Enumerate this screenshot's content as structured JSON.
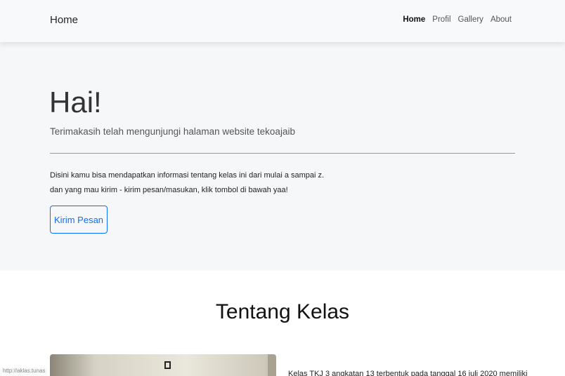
{
  "navbar": {
    "brand": "Home",
    "links": [
      {
        "label": "Home",
        "active": true
      },
      {
        "label": "Profil",
        "active": false
      },
      {
        "label": "Gallery",
        "active": false
      },
      {
        "label": "About",
        "active": false
      }
    ]
  },
  "hero": {
    "heading": "Hai!",
    "lead": "Terimakasih telah mengunjungi halaman website tekoajaib",
    "info_line1": "Disini kamu bisa mendapatkan informasi tentang kelas ini dari mulai a sampai z.",
    "info_line2": "dan yang mau kirim - kirim pesan/masukan, klik tombol di bawah yaa!",
    "button_label": "Kirim Pesan"
  },
  "about": {
    "title": "Tentang Kelas",
    "text": "Kelas TKJ 3 angkatan 13 terbentuk pada tanggal 16 juli 2020 memiliki"
  },
  "status_bar": {
    "url": "http://aklas.tunas"
  },
  "colors": {
    "accent": "#0d6efd",
    "navbar_bg": "#f8f9fa",
    "hero_bg": "#f6f7f9"
  }
}
